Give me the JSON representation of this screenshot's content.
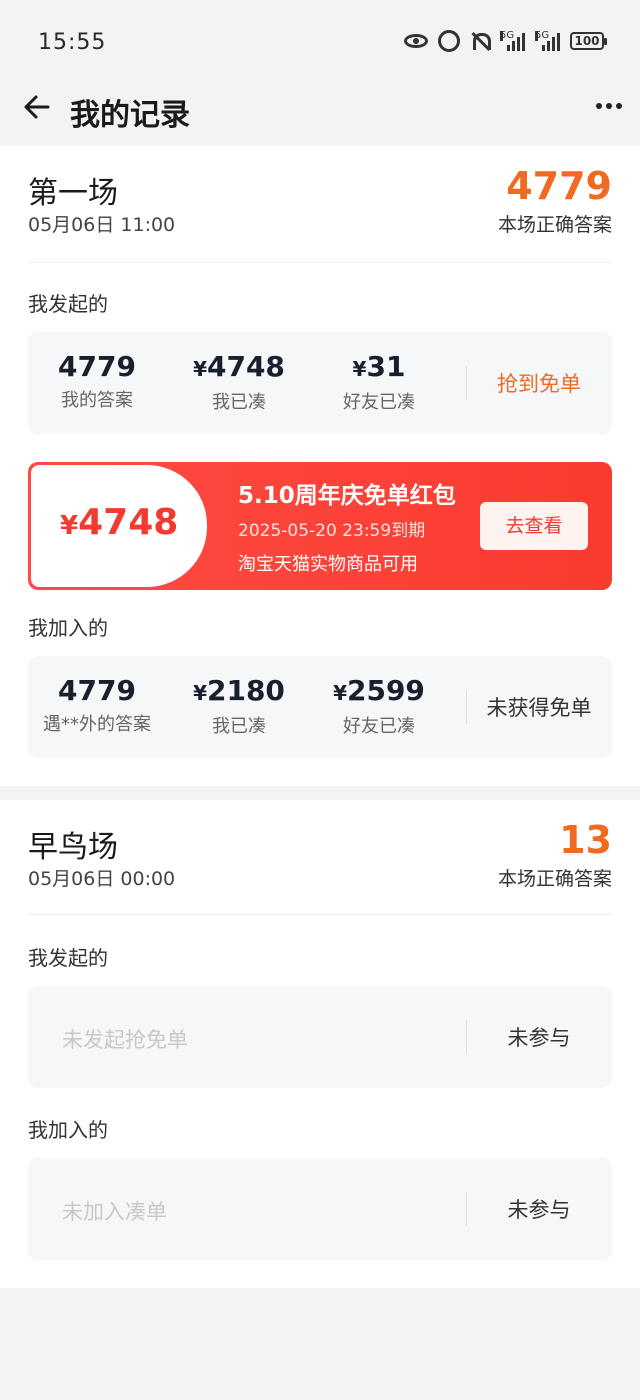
{
  "status_bar": {
    "time": "15:55",
    "icons": [
      "eye-icon",
      "alarm-icon",
      "bell-muted-icon",
      "signal-5g-icon",
      "signal-5g-icon",
      "battery-icon"
    ],
    "signal_label": "5G",
    "battery": "100"
  },
  "nav": {
    "title": "我的记录",
    "back_icon": "arrow-left-icon",
    "more_icon": "more-horizontal-icon"
  },
  "sessions": [
    {
      "title": "第一场",
      "time": "05月06日 11:00",
      "answer": "4779",
      "answer_label": "本场正确答案",
      "initiated": {
        "label": "我发起的",
        "answer": "4779",
        "answer_label": "我的答案",
        "me_amount": "4748",
        "me_label": "我已凑",
        "friend_amount": "31",
        "friend_label": "好友已凑",
        "result": "抢到免单"
      },
      "coupon": {
        "amount": "4748",
        "title": "5.10周年庆免单红包",
        "expire": "2025-05-20 23:59到期",
        "scope": "淘宝天猫实物商品可用",
        "button": "去查看"
      },
      "joined": {
        "label": "我加入的",
        "answer": "4779",
        "answer_label": "遇**外的答案",
        "me_amount": "2180",
        "me_label": "我已凑",
        "friend_amount": "2599",
        "friend_label": "好友已凑",
        "result": "未获得免单"
      }
    },
    {
      "title": "早鸟场",
      "time": "05月06日 00:00",
      "answer": "13",
      "answer_label": "本场正确答案",
      "initiated": {
        "label": "我发起的",
        "empty_text": "未发起抢免单",
        "result": "未参与"
      },
      "joined": {
        "label": "我加入的",
        "empty_text": "未加入凑单",
        "result": "未参与"
      }
    }
  ],
  "currency_symbol": "¥",
  "colors": {
    "accent": "#f06a22",
    "coupon_red": "#fa3b2f",
    "background": "#f2f3f5"
  }
}
